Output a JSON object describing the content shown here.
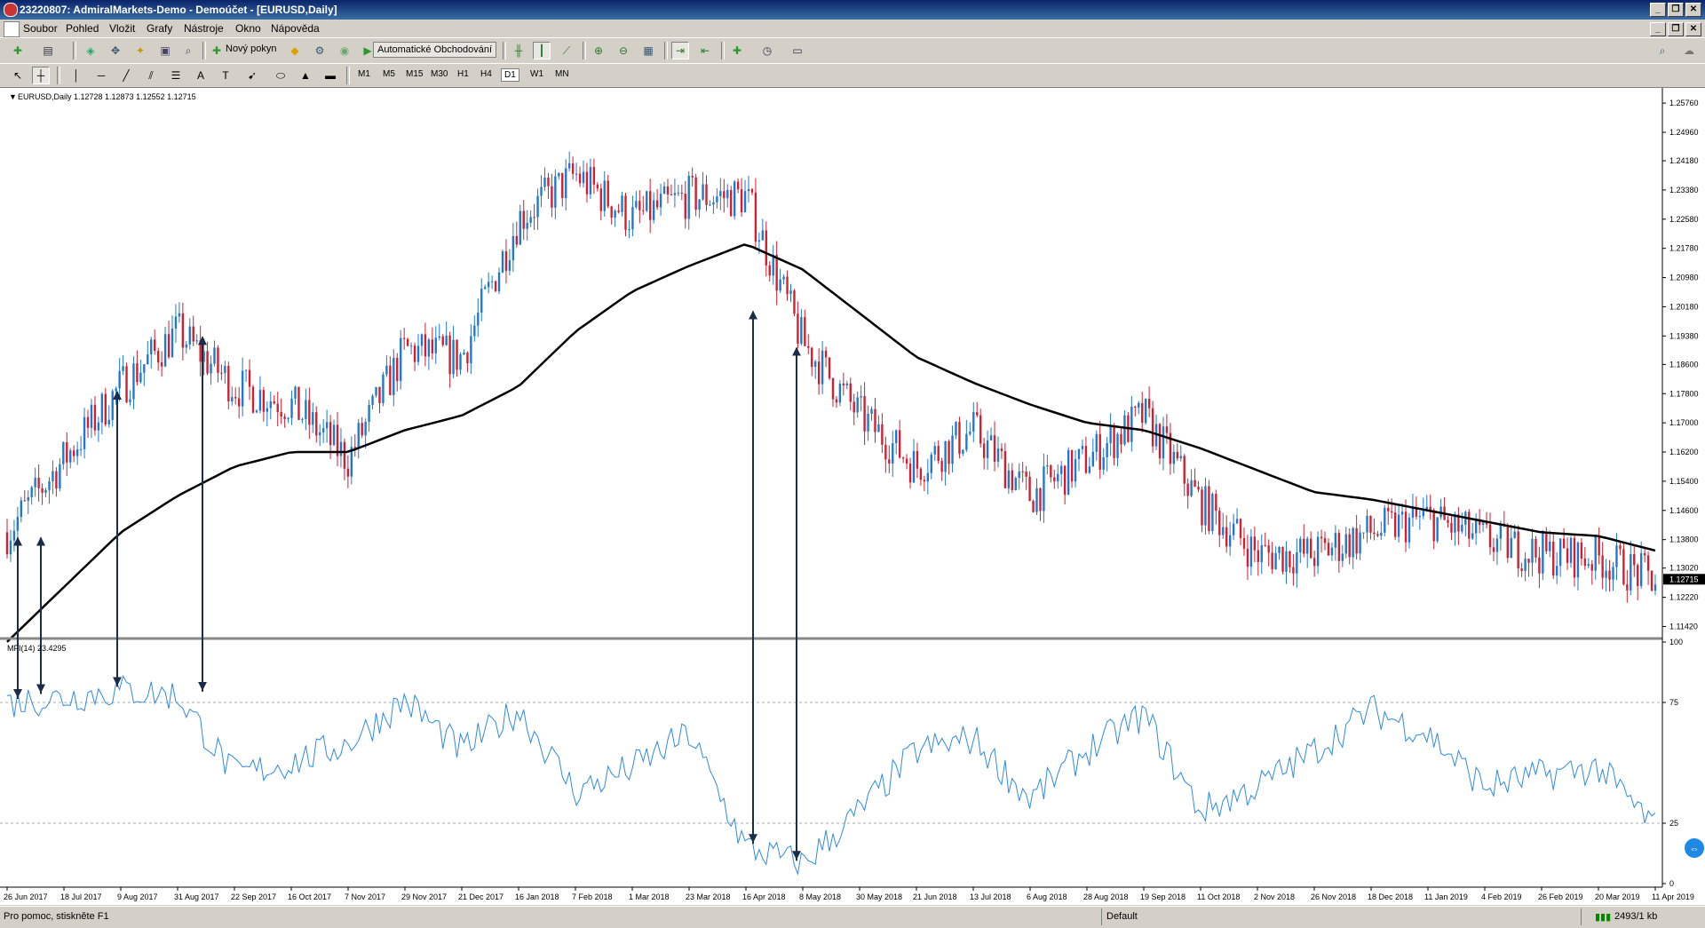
{
  "window": {
    "title": "23220807: AdmiralMarkets-Demo - Demoúčet - [EURUSD,Daily]",
    "controls": [
      "_",
      "❐",
      "✕"
    ]
  },
  "menu": [
    "Soubor",
    "Pohled",
    "Vložit",
    "Grafy",
    "Nástroje",
    "Okno",
    "Nápověda"
  ],
  "toolbar": {
    "new_order": "Nový pokyn",
    "auto_trading": "Automatické Obchodování",
    "timeframes": [
      "M1",
      "M5",
      "M15",
      "M30",
      "H1",
      "H4",
      "D1",
      "W1",
      "MN"
    ],
    "active_timeframe": "D1",
    "text_tool": "A"
  },
  "chart": {
    "header": "EURUSD,Daily  1.12728 1.12873 1.12552 1.12715",
    "price_axis": [
      "1.25760",
      "1.24960",
      "1.24180",
      "1.23380",
      "1.22580",
      "1.21780",
      "1.20980",
      "1.20180",
      "1.19380",
      "1.18600",
      "1.17800",
      "1.17000",
      "1.16200",
      "1.15400",
      "1.14600",
      "1.13800",
      "1.13020",
      "1.12220",
      "1.11420"
    ],
    "current_price": "1.12715",
    "indicator_label": "MFI(14) 23.4295",
    "indicator_axis": [
      "100",
      "75",
      "25",
      "0"
    ],
    "date_axis": [
      "26 Jun 2017",
      "18 Jul 2017",
      "9 Aug 2017",
      "31 Aug 2017",
      "22 Sep 2017",
      "16 Oct 2017",
      "7 Nov 2017",
      "29 Nov 2017",
      "21 Dec 2017",
      "16 Jan 2018",
      "7 Feb 2018",
      "1 Mar 2018",
      "23 Mar 2018",
      "16 Apr 2018",
      "8 May 2018",
      "30 May 2018",
      "21 Jun 2018",
      "13 Jul 2018",
      "6 Aug 2018",
      "28 Aug 2018",
      "19 Sep 2018",
      "11 Oct 2018",
      "2 Nov 2018",
      "26 Nov 2018",
      "18 Dec 2018",
      "11 Jan 2019",
      "4 Feb 2019",
      "26 Feb 2019",
      "20 Mar 2019",
      "11 Apr 2019"
    ],
    "colors": {
      "bull": "#1e78d2",
      "bear": "#d21e2d",
      "ma": "#000000",
      "mfi": "#2e8ae6",
      "arrow": "#1b2c48"
    }
  },
  "chart_data": [
    {
      "type": "candlestick",
      "title": "EURUSD,Daily",
      "x": [
        "26 Jun 2017",
        "18 Jul 2017",
        "9 Aug 2017",
        "31 Aug 2017",
        "22 Sep 2017",
        "16 Oct 2017",
        "7 Nov 2017",
        "29 Nov 2017",
        "21 Dec 2017",
        "16 Jan 2018",
        "7 Feb 2018",
        "1 Mar 2018",
        "23 Mar 2018",
        "16 Apr 2018",
        "8 May 2018",
        "30 May 2018",
        "21 Jun 2018",
        "13 Jul 2018",
        "6 Aug 2018",
        "28 Aug 2018",
        "19 Sep 2018",
        "11 Oct 2018",
        "2 Nov 2018",
        "26 Nov 2018",
        "18 Dec 2018",
        "11 Jan 2019",
        "4 Feb 2019",
        "26 Feb 2019",
        "20 Mar 2019",
        "11 Apr 2019"
      ],
      "series": [
        {
          "name": "Close",
          "values": [
            1.14,
            1.16,
            1.18,
            1.195,
            1.18,
            1.175,
            1.16,
            1.19,
            1.188,
            1.226,
            1.238,
            1.226,
            1.232,
            1.232,
            1.192,
            1.172,
            1.158,
            1.168,
            1.15,
            1.16,
            1.172,
            1.148,
            1.134,
            1.134,
            1.14,
            1.144,
            1.138,
            1.134,
            1.133,
            1.127
          ]
        },
        {
          "name": "Moving average",
          "values": [
            1.11,
            1.125,
            1.14,
            1.15,
            1.158,
            1.162,
            1.162,
            1.168,
            1.172,
            1.18,
            1.195,
            1.206,
            1.213,
            1.219,
            1.212,
            1.2,
            1.188,
            1.181,
            1.175,
            1.17,
            1.168,
            1.163,
            1.157,
            1.151,
            1.149,
            1.146,
            1.143,
            1.14,
            1.139,
            1.135
          ]
        }
      ],
      "ylim": [
        1.1114,
        1.2603
      ],
      "last_price": 1.12715
    },
    {
      "type": "line",
      "title": "MFI(14) 23.4295",
      "x": [
        "26 Jun 2017",
        "18 Jul 2017",
        "9 Aug 2017",
        "31 Aug 2017",
        "22 Sep 2017",
        "16 Oct 2017",
        "7 Nov 2017",
        "29 Nov 2017",
        "21 Dec 2017",
        "16 Jan 2018",
        "7 Feb 2018",
        "1 Mar 2018",
        "23 Mar 2018",
        "16 Apr 2018",
        "8 May 2018",
        "30 May 2018",
        "21 Jun 2018",
        "13 Jul 2018",
        "6 Aug 2018",
        "28 Aug 2018",
        "19 Sep 2018",
        "11 Oct 2018",
        "2 Nov 2018",
        "26 Nov 2018",
        "18 Dec 2018",
        "11 Jan 2019",
        "4 Feb 2019",
        "26 Feb 2019",
        "20 Mar 2019",
        "11 Apr 2019"
      ],
      "series": [
        {
          "name": "MFI(14)",
          "values": [
            75,
            77,
            80,
            78,
            45,
            50,
            58,
            76,
            55,
            72,
            38,
            48,
            62,
            15,
            8,
            30,
            55,
            60,
            35,
            55,
            70,
            30,
            40,
            55,
            72,
            62,
            40,
            45,
            48,
            23.4
          ]
        }
      ],
      "ylim": [
        0,
        100
      ],
      "levels": [
        75,
        25
      ]
    }
  ]
}
